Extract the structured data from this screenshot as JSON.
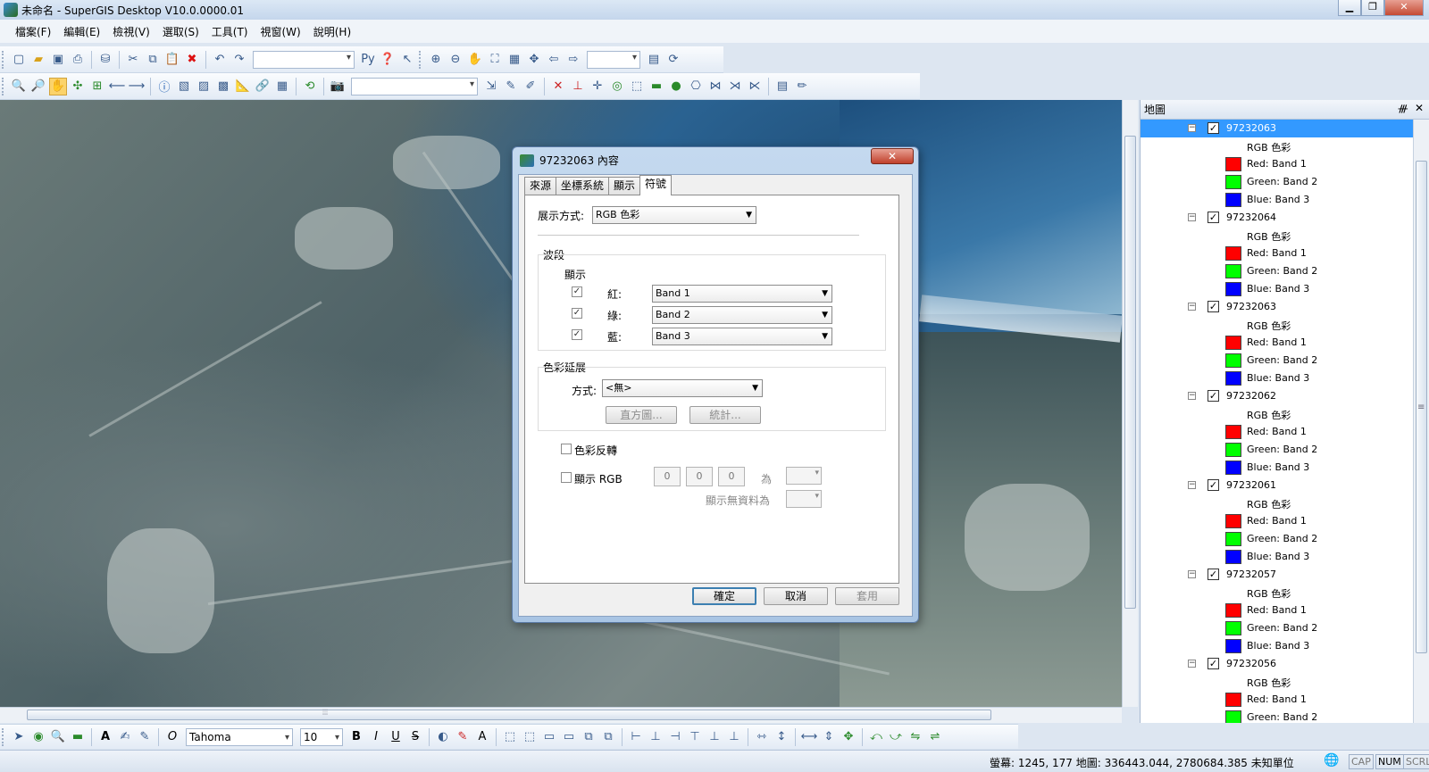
{
  "window": {
    "title": "未命名 - SuperGIS Desktop V10.0.0000.01",
    "minimize": "▁",
    "restore": "❐",
    "close": "✕"
  },
  "menu": [
    "檔案(F)",
    "編輯(E)",
    "檢視(V)",
    "選取(S)",
    "工具(T)",
    "視窗(W)",
    "說明(H)"
  ],
  "toolbar1": {
    "icons": [
      "new-icon",
      "open-icon",
      "save-icon",
      "print-icon",
      "|",
      "layer-add-icon",
      "|",
      "cut-icon",
      "copy-icon",
      "paste-icon",
      "delete-icon",
      "|",
      "undo-icon",
      "redo-icon"
    ],
    "combo1_value": "",
    "combo2_value": ""
  },
  "toolbar2": {
    "combo_value": ""
  },
  "panel": {
    "title": "地圖",
    "pin": "ᚍ",
    "close": "✕",
    "layers": [
      {
        "name": "97232063",
        "selected": true
      },
      {
        "name": "97232064",
        "selected": false
      },
      {
        "name": "97232063",
        "selected": false
      },
      {
        "name": "97232062",
        "selected": false
      },
      {
        "name": "97232061",
        "selected": false
      },
      {
        "name": "97232057",
        "selected": false
      },
      {
        "name": "97232056",
        "selected": false
      }
    ],
    "sub_label": "RGB 色彩",
    "bands": [
      {
        "label": "Red: Band 1",
        "color": "#ff0000"
      },
      {
        "label": "Green: Band 2",
        "color": "#00ff00"
      },
      {
        "label": "Blue: Band 3",
        "color": "#0000ff"
      }
    ]
  },
  "dialog": {
    "title": "97232063 內容",
    "close": "✕",
    "tabs": [
      "來源",
      "坐標系統",
      "顯示",
      "符號"
    ],
    "active_tab": "符號",
    "display_mode_label": "展示方式:",
    "display_mode_value": "RGB 色彩",
    "bands_group": "波段",
    "display_label": "顯示",
    "red_label": "紅:",
    "green_label": "綠:",
    "blue_label": "藍:",
    "red_value": "Band 1",
    "green_value": "Band 2",
    "blue_value": "Band 3",
    "stretch_group": "色彩延展",
    "method_label": "方式:",
    "method_value": "<無>",
    "histogram_btn": "直方圖...",
    "stats_btn": "統計...",
    "invert_label": "色彩反轉",
    "show_rgb_label": "顯示 RGB",
    "rgb_r": "0",
    "rgb_g": "0",
    "rgb_b": "0",
    "as_label": "為",
    "nodata_label": "顯示無資料為",
    "ok": "確定",
    "cancel": "取消",
    "apply": "套用"
  },
  "toolbar3": {
    "font": "Tahoma",
    "size": "10"
  },
  "status": {
    "coords": "螢幕: 1245, 177  地圖: 336443.044, 2780684.385 未知單位",
    "cap": "CAP",
    "num": "NUM",
    "scrl": "SCRL"
  },
  "hscroll_grip": "⦙⦙⦙",
  "vscroll_grip": "≡"
}
